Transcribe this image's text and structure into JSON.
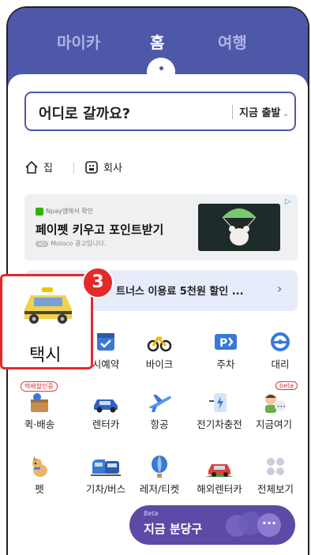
{
  "tabs": [
    {
      "label": "마이카",
      "active": false
    },
    {
      "label": "홈",
      "active": true
    },
    {
      "label": "여행",
      "active": false
    }
  ],
  "search": {
    "placeholder": "어디로 갈까요?",
    "depart_label": "지금 출발",
    "depart_chevron": "⌄"
  },
  "places": [
    {
      "label": "집",
      "icon": "home-icon"
    },
    {
      "label": "회사",
      "icon": "office-icon"
    }
  ],
  "ad": {
    "source": "Npay앱에서 확인",
    "title": "페이펫 키우고 포인트받기",
    "sub_badge": "AD",
    "sub_text": "Moloco 광고입니다."
  },
  "promo": {
    "text": "트너스 이용료 5천원 할인 ...",
    "arrow": "›"
  },
  "callout": {
    "number": "3",
    "label": "택시"
  },
  "services": [
    {
      "label": "시예약",
      "icon": "reservation-icon"
    },
    {
      "label": "바이크",
      "icon": "bike-icon"
    },
    {
      "label": "주차",
      "icon": "parking-icon"
    },
    {
      "label": "대리",
      "icon": "steering-wheel-icon"
    },
    {
      "label": "퀵·배송",
      "icon": "delivery-icon",
      "badge": "택배할인중"
    },
    {
      "label": "렌터카",
      "icon": "rental-car-icon"
    },
    {
      "label": "항공",
      "icon": "airplane-icon"
    },
    {
      "label": "전기차충전",
      "icon": "ev-charger-icon"
    },
    {
      "label": "지금여기",
      "icon": "people-chat-icon",
      "badge": "beta"
    },
    {
      "label": "펫",
      "icon": "dog-icon"
    },
    {
      "label": "기차/버스",
      "icon": "train-icon"
    },
    {
      "label": "레저/티켓",
      "icon": "balloon-icon"
    },
    {
      "label": "해외렌터카",
      "icon": "overseas-car-icon"
    },
    {
      "label": "전체보기",
      "icon": "grid-dots-icon"
    }
  ],
  "floating": {
    "beta": "Beta",
    "text": "지금 분당구",
    "more": "···"
  },
  "colors": {
    "brand": "#4e58a8",
    "highlight": "#e32a2a",
    "floating": "#5c4aa6"
  }
}
